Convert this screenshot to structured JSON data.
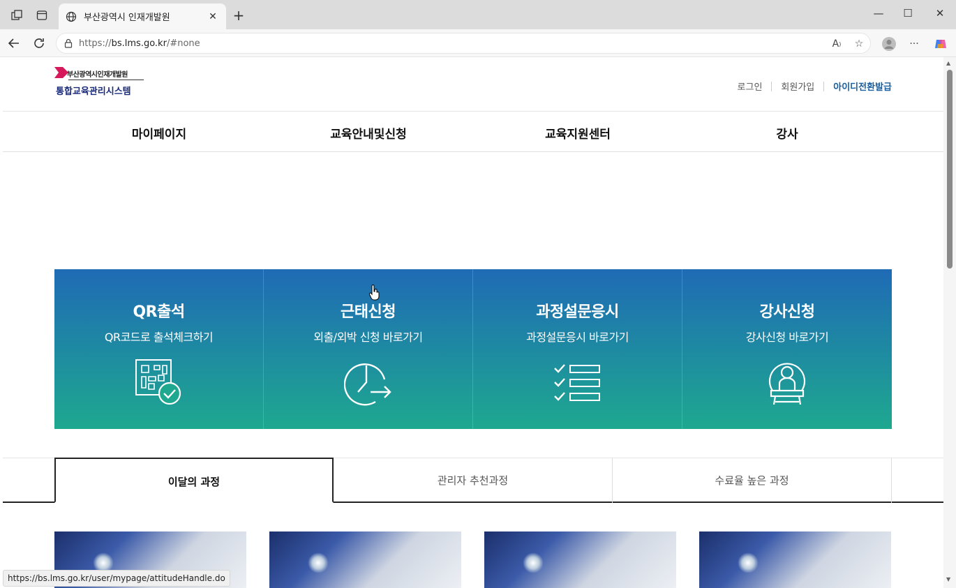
{
  "browser": {
    "tab_title": "부산광역시 인재개발원",
    "url_prefix": "https://",
    "url_host": "bs.lms.go.kr",
    "url_path": "/#none",
    "status_url": "https://bs.lms.go.kr/user/mypage/attitudeHandle.do"
  },
  "header": {
    "logo_top": "부산광역시인재개발원",
    "logo_bottom": "통합교육관리시스템",
    "util": [
      "로그인",
      "회원가입",
      "아이디전환발급"
    ]
  },
  "gnb": [
    "마이페이지",
    "교육안내및신청",
    "교육지원센터",
    "강사"
  ],
  "quick": [
    {
      "title": "QR출석",
      "sub": "QR코드로 출석체크하기",
      "icon": "qr-check-icon"
    },
    {
      "title": "근태신청",
      "sub": "외출/외박 신청 바로가기",
      "icon": "clock-arrow-icon"
    },
    {
      "title": "과정설문응시",
      "sub": "과정설문응시 바로가기",
      "icon": "checklist-icon"
    },
    {
      "title": "강사신청",
      "sub": "강사신청 바로가기",
      "icon": "lecturer-icon"
    }
  ],
  "course_tabs": [
    "이달의 과정",
    "관리자 추천과정",
    "수료율 높은 과정"
  ],
  "colors": {
    "accent": "#1a5fa0",
    "quick_top": "#1f6bb5",
    "quick_bottom": "#1ea88f"
  }
}
